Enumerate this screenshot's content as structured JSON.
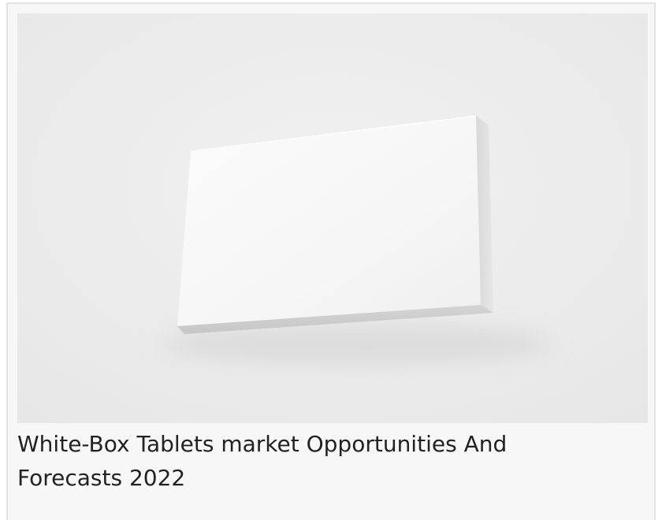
{
  "article": {
    "image_alt": "White box mockup on grey background",
    "title": "White-Box Tablets market Opportunities And Forecasts 2022"
  }
}
